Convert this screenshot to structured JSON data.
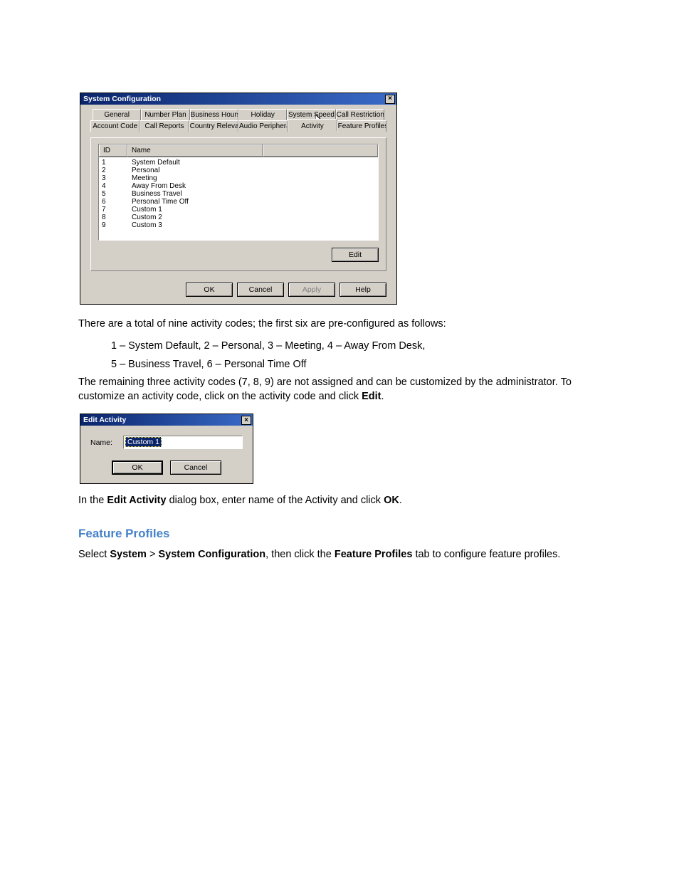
{
  "dialog1": {
    "title": "System Configuration",
    "tabs_row1": [
      "General",
      "Number Plan",
      "Business Hours",
      "Holiday",
      "System Speed",
      "Call Restriction"
    ],
    "tabs_row2": [
      "Account Code",
      "Call Reports",
      "Country Relevant",
      "Audio Peripheral",
      "Activity",
      "Feature Profiles"
    ],
    "active_tab": "Activity",
    "list_headers": {
      "id": "ID",
      "name": "Name"
    },
    "rows": [
      {
        "id": "1",
        "name": "System Default"
      },
      {
        "id": "2",
        "name": "Personal"
      },
      {
        "id": "3",
        "name": "Meeting"
      },
      {
        "id": "4",
        "name": "Away From Desk"
      },
      {
        "id": "5",
        "name": "Business Travel"
      },
      {
        "id": "6",
        "name": "Personal Time Off"
      },
      {
        "id": "7",
        "name": "Custom 1"
      },
      {
        "id": "8",
        "name": "Custom 2"
      },
      {
        "id": "9",
        "name": "Custom 3"
      }
    ],
    "edit_label": "Edit",
    "footer": {
      "ok": "OK",
      "cancel": "Cancel",
      "apply": "Apply",
      "help": "Help"
    }
  },
  "text": {
    "p1": "There are a total of nine activity codes; the first six are pre-configured as follows:",
    "l1": "1 – System Default, 2 – Personal, 3 – Meeting, 4 – Away From Desk,",
    "l2": "5 – Business Travel, 6 – Personal Time Off",
    "p2a": "The remaining three activity codes (7, 8, 9) are not assigned and can be customized by the administrator. To customize an activity code, click on the activity code and click ",
    "p2b": "Edit",
    "p2c": ".",
    "p3a": "In the ",
    "p3b": "Edit Activity",
    "p3c": " dialog box, enter name of the Activity and click ",
    "p3d": "OK",
    "p3e": ".",
    "h1": "Feature Profiles",
    "f1a": "Select ",
    "f1b": "System",
    "f1c": " > ",
    "f1d": "System Configuration",
    "f1e": ", then click the ",
    "f1f": "Feature Profiles",
    "f1g": " tab to configure feature profiles."
  },
  "dialog2": {
    "title": "Edit Activity",
    "name_label": "Name:",
    "name_value": "Custom 1",
    "ok": "OK",
    "cancel": "Cancel"
  }
}
